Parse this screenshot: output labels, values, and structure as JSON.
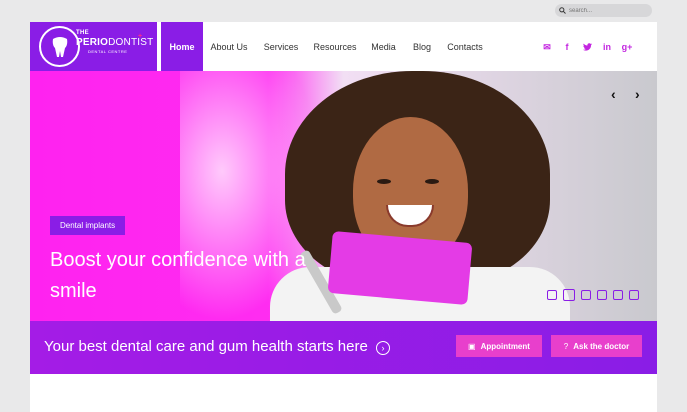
{
  "search": {
    "placeholder": "search..."
  },
  "logo": {
    "the": "THE",
    "name_bold": "PERIO",
    "name_rest": "DONTIST",
    "sub": "DENTAL CENTRE",
    "plus": "+"
  },
  "nav": {
    "items": [
      {
        "label": "Home",
        "active": true
      },
      {
        "label": "About Us"
      },
      {
        "label": "Services"
      },
      {
        "label": "Resources"
      },
      {
        "label": "Media"
      },
      {
        "label": "Blog"
      },
      {
        "label": "Contacts"
      }
    ]
  },
  "social": [
    {
      "icon": "mail-icon",
      "glyph": "✉"
    },
    {
      "icon": "facebook-icon",
      "glyph": "f"
    },
    {
      "icon": "twitter-icon",
      "glyph": "🐦"
    },
    {
      "icon": "linkedin-icon",
      "glyph": "in"
    },
    {
      "icon": "google-plus-icon",
      "glyph": "g+"
    }
  ],
  "hero": {
    "badge": "Dental implants",
    "headline_line1": "Boost your confidence with a",
    "headline_line2": "smile",
    "prev": "‹",
    "next": "›",
    "slides": 6,
    "active_slide": 2
  },
  "band": {
    "tagline": "Your best dental care and gum health starts here",
    "appointment_label": "Appointment",
    "ask_label": "Ask the doctor"
  },
  "colors": {
    "brand_purple": "#8a1de6",
    "brand_pink": "#e83fcc",
    "hero_magenta": "#ff22f0"
  }
}
